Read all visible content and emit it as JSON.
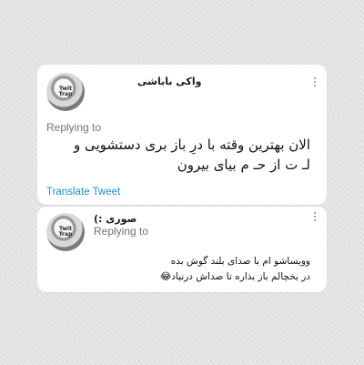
{
  "tweets": [
    {
      "avatar_text": "Twit Trap",
      "name": "واکی باباشی",
      "replying": "Replying to",
      "lines": [
        "الان بهترین وقته با درِ باز بری دستشویی و",
        "لـ ت از حـ م بیای بیرون"
      ],
      "translate": "Translate Tweet"
    },
    {
      "avatar_text": "Twit Trap",
      "name": "صوری :)",
      "replying": "Replying to",
      "lines": [
        "وویساشو ام با صدای بلند گوش بده",
        "در یخچالم باز بذاره تا صداش درنیاد😂"
      ]
    }
  ]
}
